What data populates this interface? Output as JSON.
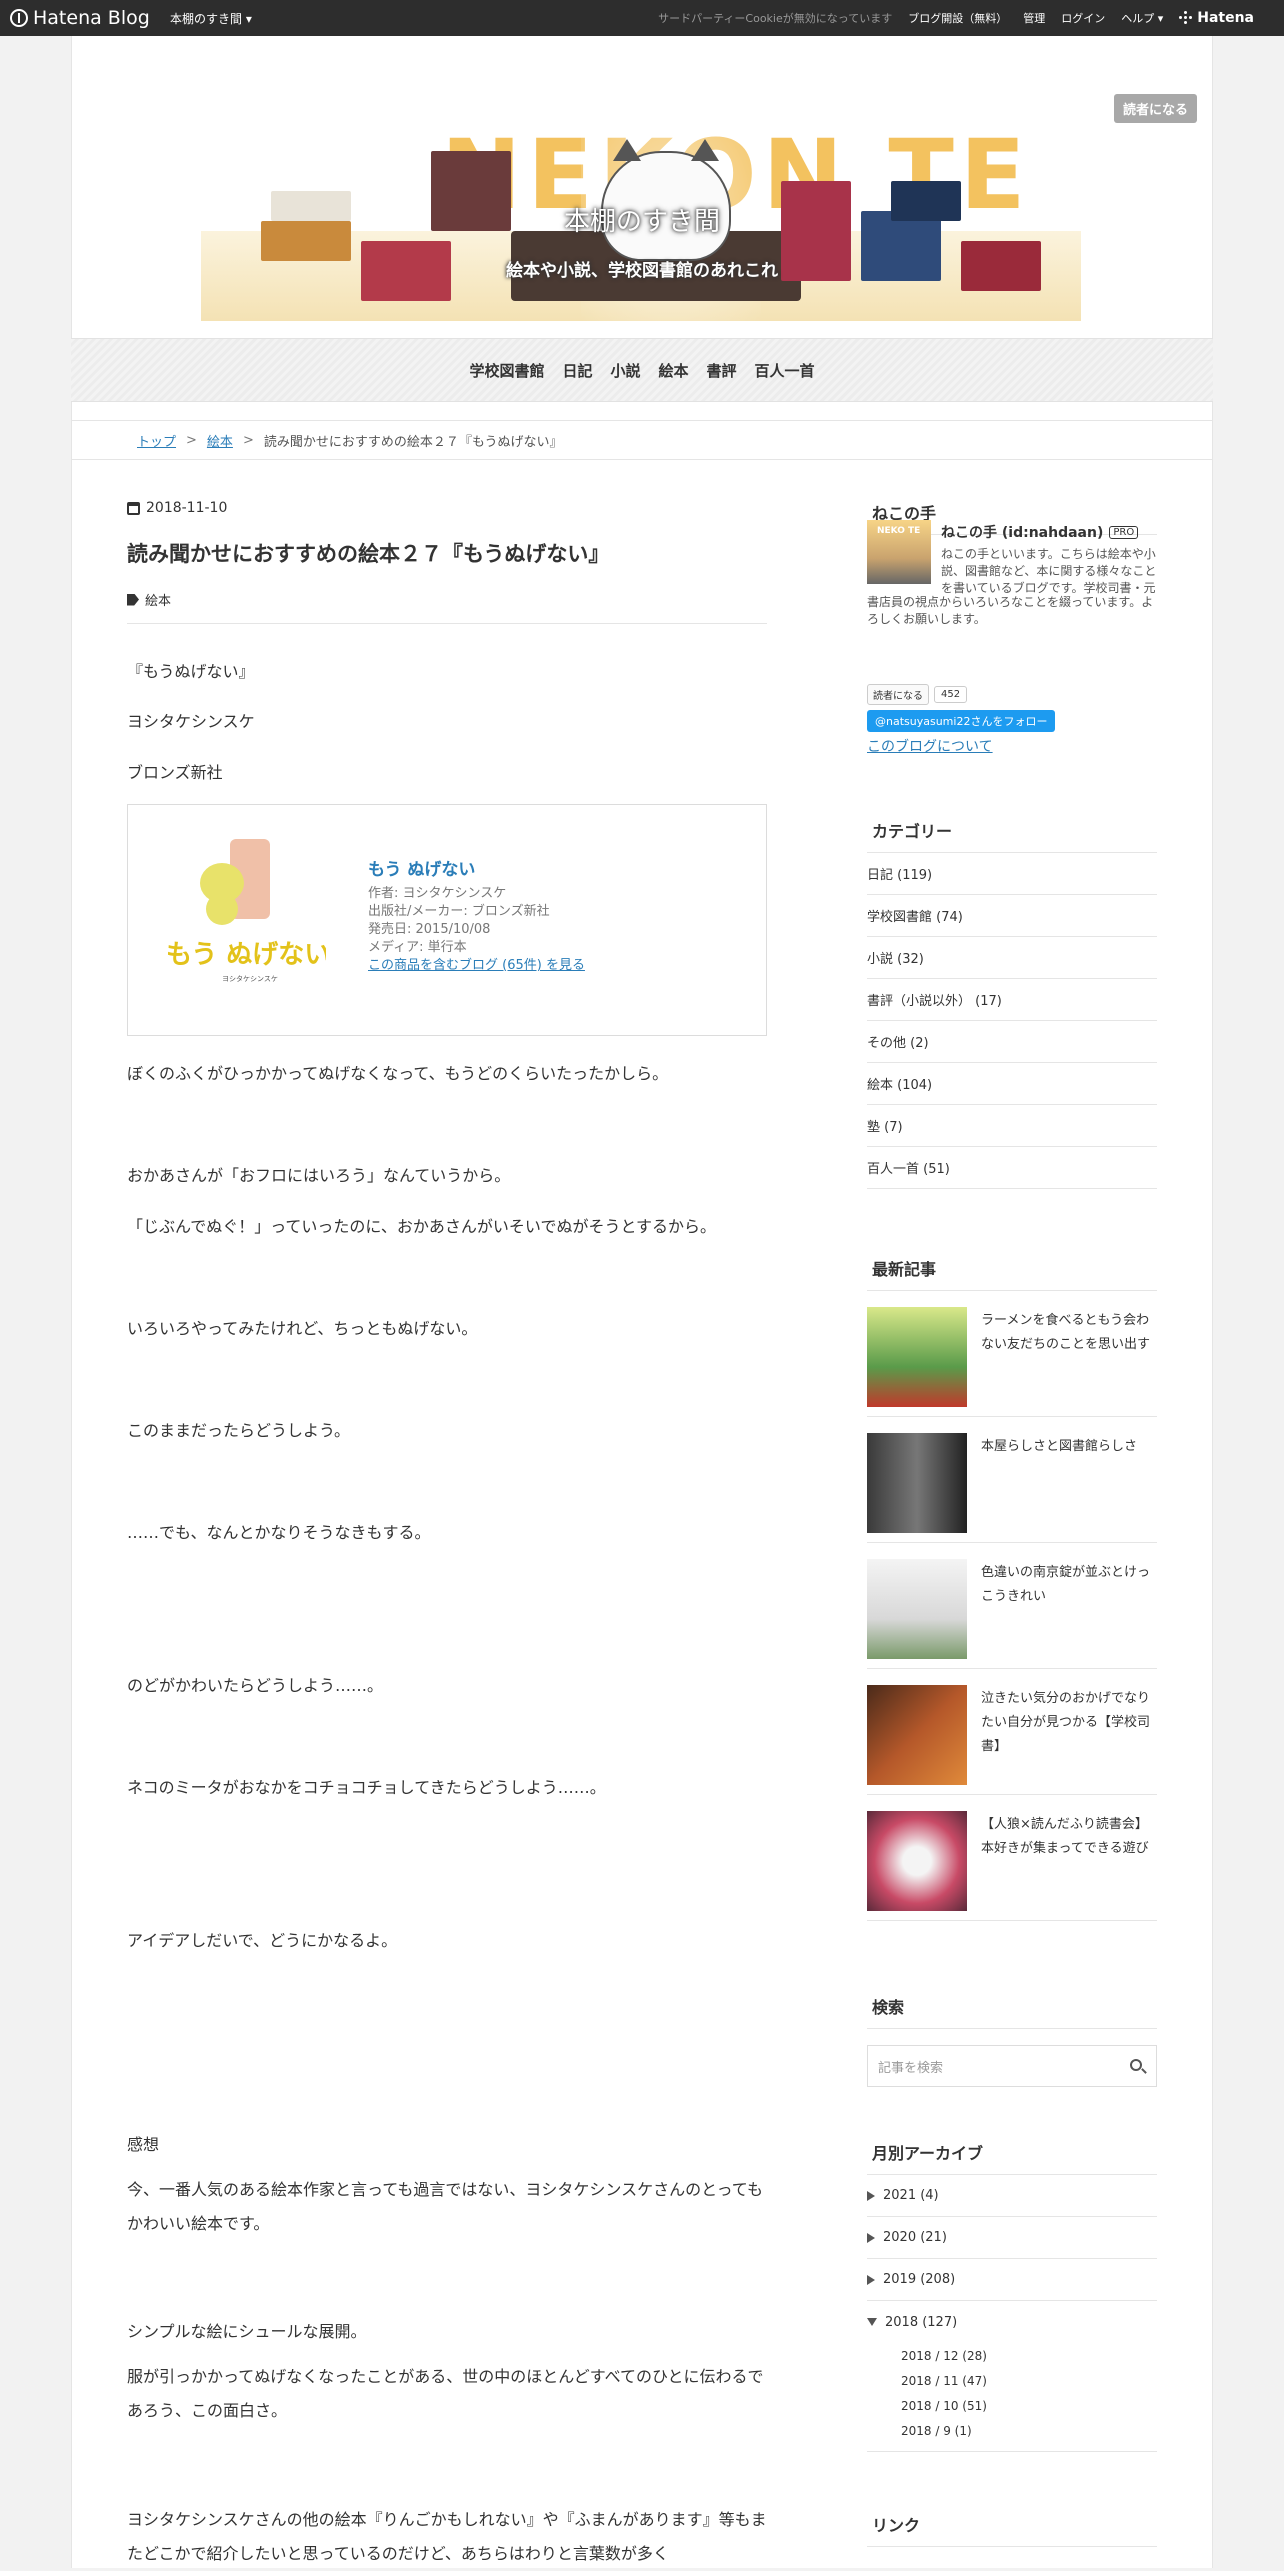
{
  "topbar": {
    "logo": "Hatena Blog",
    "blog_menu": "本棚のすき間 ▾",
    "cookie_notice": "サードパーティーCookieが無効になっています",
    "open_blog": "ブログ開設（無料）",
    "admin": "管理",
    "login": "ログイン",
    "help": "ヘルプ ▾",
    "hatena": "Hatena"
  },
  "reader_button": "読者になる",
  "header": {
    "banner_text": "NEKON TE",
    "title": "本棚のすき間",
    "description": "絵本や小説、学校図書館のあれこれ"
  },
  "nav": [
    "学校図書館",
    "日記",
    "小説",
    "絵本",
    "書評",
    "百人一首"
  ],
  "breadcrumb": {
    "top": "トップ",
    "sep": ">",
    "category": "絵本",
    "current": "読み聞かせにおすすめの絵本２７『もうぬげない』"
  },
  "article": {
    "date": "2018-11-10",
    "title": "読み聞かせにおすすめの絵本２７『もうぬげない』",
    "category": "絵本",
    "book_title_line": "『もうぬげない』",
    "author_line": "ヨシタケシンスケ",
    "publisher_line": "ブロンズ新社",
    "embed": {
      "cover_text": "もう ぬげない",
      "cover_author": "ヨシタケシンスケ",
      "title": "もう ぬげない",
      "author": "作者: ヨシタケシンスケ",
      "publisher": "出版社/メーカー: ブロンズ新社",
      "release": "発売日: 2015/10/08",
      "media": "メディア: 単行本",
      "link": "この商品を含むブログ (65件) を見る"
    },
    "paragraphs": [
      "ぼくのふくがひっかかってぬげなくなって、もうどのくらいたったかしら。",
      "おかあさんが「おフロにはいろう」なんていうから。",
      "「じぶんでぬぐ！」っていったのに、おかあさんがいそいでぬがそうとするから。",
      "いろいろやってみたけれど、ちっともぬげない。",
      "このままだったらどうしよう。",
      "……でも、なんとかなりそうなきもする。",
      "のどがかわいたらどうしよう……。",
      "ネコのミータがおなかをコチョコチョしてきたらどうしよう……。",
      "アイデアしだいで、どうにかなるよ。",
      "感想",
      "今、一番人気のある絵本作家と言っても過言ではない、ヨシタケシンスケさんのとってもかわいい絵本です。",
      "シンプルな絵にシュールな展開。",
      "服が引っかかってぬげなくなったことがある、世の中のほとんどすべてのひとに伝わるであろう、この面白さ。",
      "ヨシタケシンスケさんの他の絵本『りんごかもしれない』や『ふまんがあります』等もまたどこかで紹介したいと思っているのだけど、あちらはわりと言葉数が多く"
    ]
  },
  "sidebar": {
    "profile": {
      "heading": "ねこの手",
      "avatar_text": "NEKO TE",
      "name": "ねこの手 (id:nahdaan)",
      "badge": "PRO",
      "desc1": "ねこの手といいます。こちらは絵本や小説、図書館など、本に関する様々なことを書いているブログです。学校司書・元",
      "desc2": "書店員の視点からいろいろなことを綴っています。よろしくお願いします。",
      "reader_btn": "読者になる",
      "reader_count": "452",
      "twitter": "@natsuyasumi22さんをフォロー",
      "about": "このブログについて"
    },
    "categories": {
      "heading": "カテゴリー",
      "items": [
        "日記 (119)",
        "学校図書館 (74)",
        "小説 (32)",
        "書評（小説以外） (17)",
        "その他 (2)",
        "絵本 (104)",
        "塾 (7)",
        "百人一首 (51)"
      ]
    },
    "recent": {
      "heading": "最新記事",
      "items": [
        {
          "title": "ラーメンを食べるともう会わない友だちのことを思い出す",
          "color": "#5a9b4a"
        },
        {
          "title": "本屋らしさと図書館らしさ",
          "color": "#3a3a3a"
        },
        {
          "title": "色違いの南京錠が並ぶとけっこうきれい",
          "color": "#eaeaea"
        },
        {
          "title": "泣きたい気分のおかげでなりたい自分が見つかる【学校司書】",
          "color": "#b5582a"
        },
        {
          "title": "【人狼×読んだふり読書会】本好きが集まってできる遊び",
          "color": "#c84a66"
        }
      ]
    },
    "search": {
      "heading": "検索",
      "placeholder": "記事を検索"
    },
    "archive": {
      "heading": "月別アーカイブ",
      "years": [
        "2021 (4)",
        "2020 (21)",
        "2019 (208)"
      ],
      "open_year": "2018 (127)",
      "months": [
        "2018 / 12 (28)",
        "2018 / 11 (47)",
        "2018 / 10 (51)",
        "2018 / 9 (1)"
      ]
    },
    "links": {
      "heading": "リンク"
    }
  }
}
